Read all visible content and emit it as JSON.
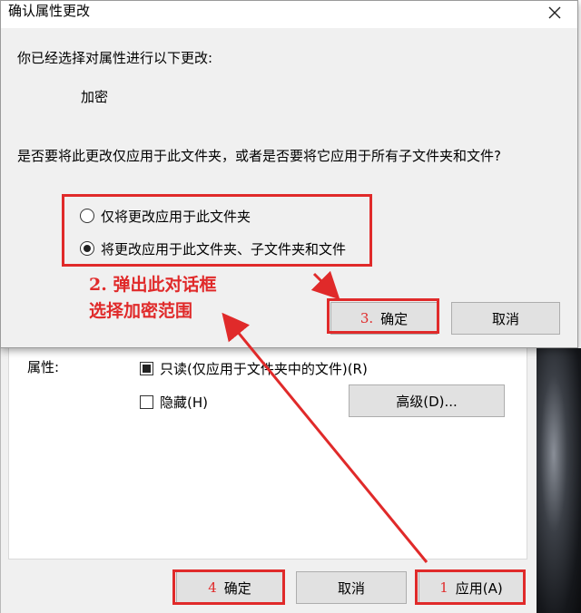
{
  "dialog": {
    "title": "确认属性更改",
    "intro": "你已经选择对属性进行以下更改:",
    "change_item": "加密",
    "question": "是否要将此更改仅应用于此文件夹，或者是否要将它应用于所有子文件夹和文件?",
    "option_folder_only": "仅将更改应用于此文件夹",
    "option_recursive": "将更改应用于此文件夹、子文件夹和文件",
    "selected_option": "option_recursive",
    "ok_label": "确定",
    "cancel_label": "取消"
  },
  "properties": {
    "attributes_label": "属性:",
    "readonly_label": "只读(仅应用于文件夹中的文件)(R)",
    "readonly_state": "indeterminate",
    "hidden_label": "隐藏(H)",
    "hidden_checked": false,
    "advanced_label": "高级(D)...",
    "ok_label": "确定",
    "cancel_label": "取消",
    "apply_label": "应用(A)"
  },
  "annotations": {
    "step2_line1": "2. 弹出此对话框",
    "step2_line2": "选择加密范围",
    "step3_num": "3.",
    "step4_num": "4",
    "step1_num": "1",
    "color": "#e02a2a"
  },
  "icons": {
    "close": "close-icon",
    "arrow": "arrow-annotation"
  }
}
